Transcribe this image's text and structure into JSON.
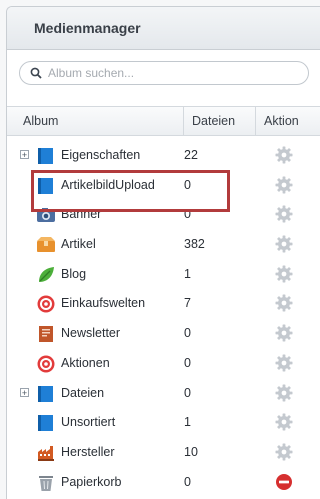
{
  "app": {
    "title": "Medienmanager"
  },
  "search": {
    "placeholder": "Album suchen..."
  },
  "columns": {
    "album": "Album",
    "files": "Dateien",
    "action": "Aktion"
  },
  "albums": [
    {
      "label": "Eigenschaften",
      "count": "22",
      "icon": "folder-blue-icon",
      "expandable": true,
      "action": "settings-gear-icon"
    },
    {
      "label": "ArtikelbildUpload",
      "count": "0",
      "icon": "folder-blue-icon",
      "expandable": false,
      "action": "settings-gear-icon",
      "highlighted": true
    },
    {
      "label": "Banner",
      "count": "0",
      "icon": "camera-icon",
      "expandable": false,
      "action": "settings-gear-icon"
    },
    {
      "label": "Artikel",
      "count": "382",
      "icon": "package-icon",
      "expandable": false,
      "action": "settings-gear-icon"
    },
    {
      "label": "Blog",
      "count": "1",
      "icon": "leaf-icon",
      "expandable": false,
      "action": "settings-gear-icon"
    },
    {
      "label": "Einkaufswelten",
      "count": "7",
      "icon": "target-icon",
      "expandable": false,
      "action": "settings-gear-icon"
    },
    {
      "label": "Newsletter",
      "count": "0",
      "icon": "newsletter-icon",
      "expandable": false,
      "action": "settings-gear-icon"
    },
    {
      "label": "Aktionen",
      "count": "0",
      "icon": "target-icon",
      "expandable": false,
      "action": "settings-gear-icon"
    },
    {
      "label": "Dateien",
      "count": "0",
      "icon": "folder-blue-icon",
      "expandable": true,
      "action": "settings-gear-icon"
    },
    {
      "label": "Unsortiert",
      "count": "1",
      "icon": "folder-blue-icon",
      "expandable": false,
      "action": "settings-gear-icon"
    },
    {
      "label": "Hersteller",
      "count": "10",
      "icon": "factory-icon",
      "expandable": false,
      "action": "settings-gear-icon"
    },
    {
      "label": "Papierkorb",
      "count": "0",
      "icon": "trash-icon",
      "expandable": false,
      "action": "delete-icon"
    }
  ],
  "colors": {
    "highlight": "#b23b3c",
    "folder": "#1f7fd6",
    "delete": "#d62f2f"
  }
}
